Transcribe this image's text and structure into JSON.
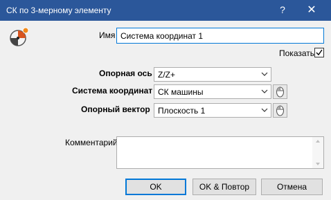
{
  "window": {
    "title": "СК по 3-мерному элементу",
    "help_label": "?",
    "close_label": "✕",
    "icon": "coordinate-system-icon"
  },
  "form": {
    "name_label": "Имя",
    "name_value": "Система координат 1",
    "show_label": "Показать",
    "show_checked": true,
    "ref_axis_label": "Опорная ось",
    "ref_axis_value": "Z/Z+",
    "coord_sys_label": "Система координат",
    "coord_sys_value": "СК машины",
    "ref_vector_label": "Опорный вектор",
    "ref_vector_value": "Плоскость 1",
    "comment_label": "Комментарий",
    "comment_value": ""
  },
  "buttons": {
    "ok": "OK",
    "ok_repeat": "OK & Повтор",
    "cancel": "Отмена"
  },
  "colors": {
    "titlebar": "#2b579a",
    "accent": "#0078d7",
    "background": "#f0f0f0"
  }
}
